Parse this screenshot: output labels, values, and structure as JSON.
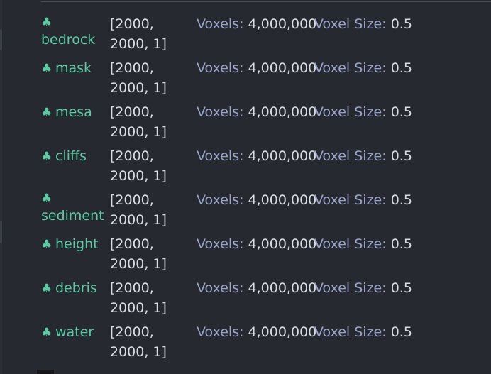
{
  "layers": [
    {
      "name": "bedrock",
      "icon": "clover-icon",
      "shape": "[2000, 2000, 1]",
      "voxels_label": "Voxels:",
      "voxels_value": "4,000,000",
      "voxel_size_label": "Voxel Size:",
      "voxel_size_value": "0.5"
    },
    {
      "name": "mask",
      "icon": "clover-icon",
      "shape": "[2000, 2000, 1]",
      "voxels_label": "Voxels:",
      "voxels_value": "4,000,000",
      "voxel_size_label": "Voxel Size:",
      "voxel_size_value": "0.5"
    },
    {
      "name": "mesa",
      "icon": "clover-icon",
      "shape": "[2000, 2000, 1]",
      "voxels_label": "Voxels:",
      "voxels_value": "4,000,000",
      "voxel_size_label": "Voxel Size:",
      "voxel_size_value": "0.5"
    },
    {
      "name": "cliffs",
      "icon": "clover-icon",
      "shape": "[2000, 2000, 1]",
      "voxels_label": "Voxels:",
      "voxels_value": "4,000,000",
      "voxel_size_label": "Voxel Size:",
      "voxel_size_value": "0.5"
    },
    {
      "name": "sediment",
      "icon": "clover-icon",
      "shape": "[2000, 2000, 1]",
      "voxels_label": "Voxels:",
      "voxels_value": "4,000,000",
      "voxel_size_label": "Voxel Size:",
      "voxel_size_value": "0.5"
    },
    {
      "name": "height",
      "icon": "clover-icon",
      "shape": "[2000, 2000, 1]",
      "voxels_label": "Voxels:",
      "voxels_value": "4,000,000",
      "voxel_size_label": "Voxel Size:",
      "voxel_size_value": "0.5"
    },
    {
      "name": "debris",
      "icon": "clover-icon",
      "shape": "[2000, 2000, 1]",
      "voxels_label": "Voxels:",
      "voxels_value": "4,000,000",
      "voxel_size_label": "Voxel Size:",
      "voxel_size_value": "0.5"
    },
    {
      "name": "water",
      "icon": "clover-icon",
      "shape": "[2000, 2000, 1]",
      "voxels_label": "Voxels:",
      "voxels_value": "4,000,000",
      "voxel_size_label": "Voxel Size:",
      "voxel_size_value": "0.5"
    }
  ],
  "bottom_partial_text": "",
  "colors": {
    "background": "#262930",
    "layer_name": "#5ec9a5",
    "metric_key": "#9aa3c7",
    "metric_value": "#d9dce1"
  }
}
